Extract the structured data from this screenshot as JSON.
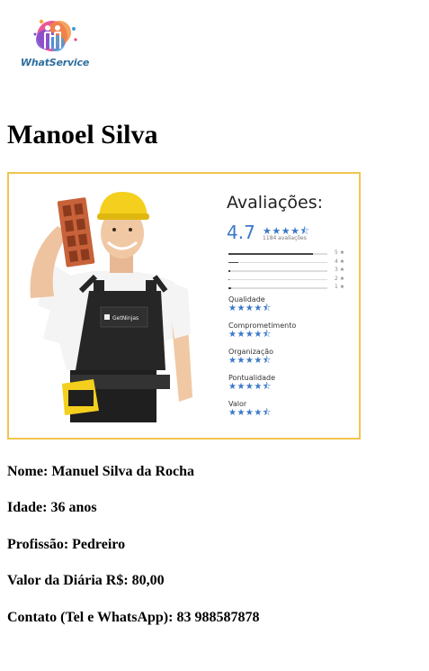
{
  "logo": {
    "text": "WhatService"
  },
  "profile": {
    "name": "Manoel Silva"
  },
  "card": {
    "badge_text": "GetNinjas",
    "reviews_title": "Avaliações:",
    "score": "4.7",
    "score_stars": "★★★★⯪",
    "count": "1184 avaliações",
    "distribution": [
      {
        "label": "5 ★",
        "fraction": 0.85
      },
      {
        "label": "4 ★",
        "fraction": 0.1
      },
      {
        "label": "3 ★",
        "fraction": 0.02
      },
      {
        "label": "2 ★",
        "fraction": 0.01
      },
      {
        "label": "1 ★",
        "fraction": 0.03
      }
    ],
    "categories": [
      {
        "name": "Qualidade",
        "stars": "★★★★⯪"
      },
      {
        "name": "Comprometimento",
        "stars": "★★★★⯪"
      },
      {
        "name": "Organização",
        "stars": "★★★★⯪"
      },
      {
        "name": "Pontualidade",
        "stars": "★★★★⯪"
      },
      {
        "name": "Valor",
        "stars": "★★★★⯪"
      }
    ]
  },
  "details": {
    "nome": "Nome: Manuel Silva da Rocha",
    "idade": "Idade: 36 anos",
    "profissao": "Profissão: Pedreiro",
    "valor": "Valor da Diária R$: 80,00",
    "contato": "Contato (Tel e WhatsApp): 83 988587878"
  },
  "colors": {
    "accent": "#3b78c9",
    "card_border": "#f2c44f",
    "helmet": "#f4cf1e",
    "brick": "#c8623a"
  }
}
